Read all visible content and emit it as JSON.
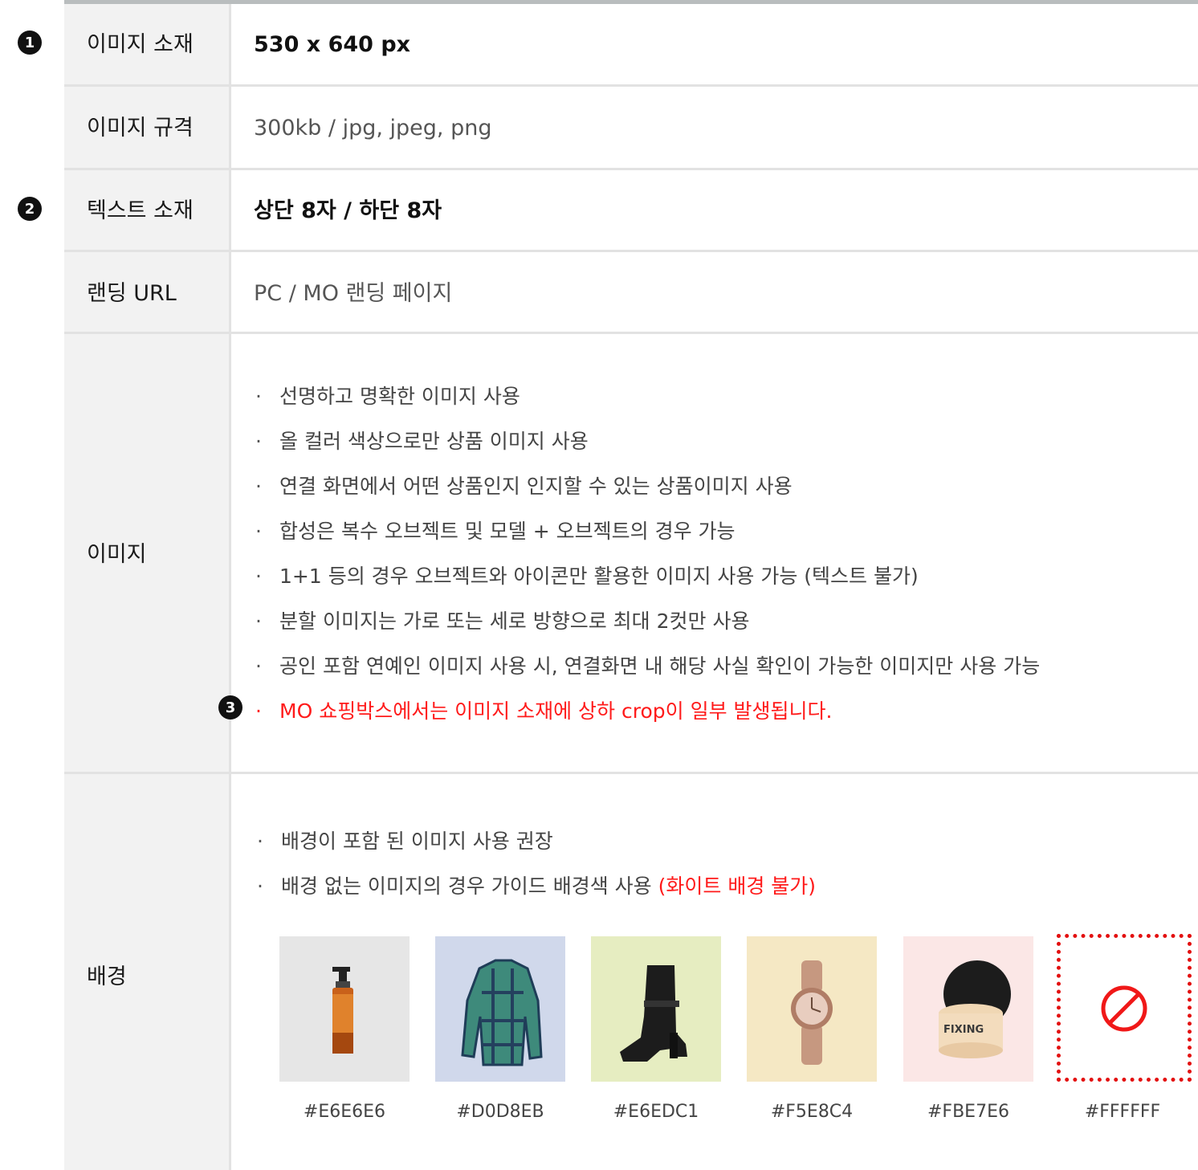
{
  "rows": [
    {
      "marker": "1",
      "label": "이미지 소재",
      "value": "530 x 640 px"
    },
    {
      "label": "이미지 규격",
      "value": "300kb / jpg, jpeg, png"
    },
    {
      "marker": "2",
      "label": "텍스트 소재",
      "value": "상단 8자 / 하단 8자"
    },
    {
      "label": "랜딩 URL",
      "value": "PC / MO 랜딩 페이지"
    }
  ],
  "image_section": {
    "label": "이미지",
    "bullets": [
      "선명하고 명확한 이미지 사용",
      "올 컬러 색상으로만 상품 이미지 사용",
      "연결 화면에서 어떤 상품인지 인지할 수 있는 상품이미지 사용",
      "합성은 복수 오브젝트 및 모델 + 오브젝트의 경우 가능",
      "1+1 등의 경우 오브젝트와 아이콘만 활용한 이미지 사용 가능 (텍스트 불가)",
      "분할 이미지는 가로 또는 세로 방향으로 최대 2컷만 사용",
      "공인 포함 연예인 이미지 사용 시, 연결화면 내 해당 사실 확인이 가능한 이미지만 사용 가능"
    ],
    "warning_marker": "3",
    "warning": "MO 쇼핑박스에서는 이미지 소재에 상하 crop이 일부 발생됩니다.",
    "bullet_symbol": "·"
  },
  "background_section": {
    "label": "배경",
    "bullets": [
      "배경이 포함 된 이미지 사용 권장",
      "배경 없는 이미지의 경우 가이드 배경색 사용"
    ],
    "bullet_note": "(화이트 배경 불가)",
    "swatches": [
      {
        "color": "#E6E6E6",
        "label": "#E6E6E6",
        "icon": "oil-bottle-icon"
      },
      {
        "color": "#D0D8EB",
        "label": "#D0D8EB",
        "icon": "plaid-shirt-icon"
      },
      {
        "color": "#E6EDC1",
        "label": "#E6EDC1",
        "icon": "boot-icon"
      },
      {
        "color": "#F5E8C4",
        "label": "#F5E8C4",
        "icon": "watch-icon"
      },
      {
        "color": "#FBE7E6",
        "label": "#FBE7E6",
        "icon": "cream-jar-icon",
        "product_text": "FIXING"
      },
      {
        "color": "#FFFFFF",
        "label": "#FFFFFF",
        "icon": "prohibited-icon"
      }
    ]
  }
}
